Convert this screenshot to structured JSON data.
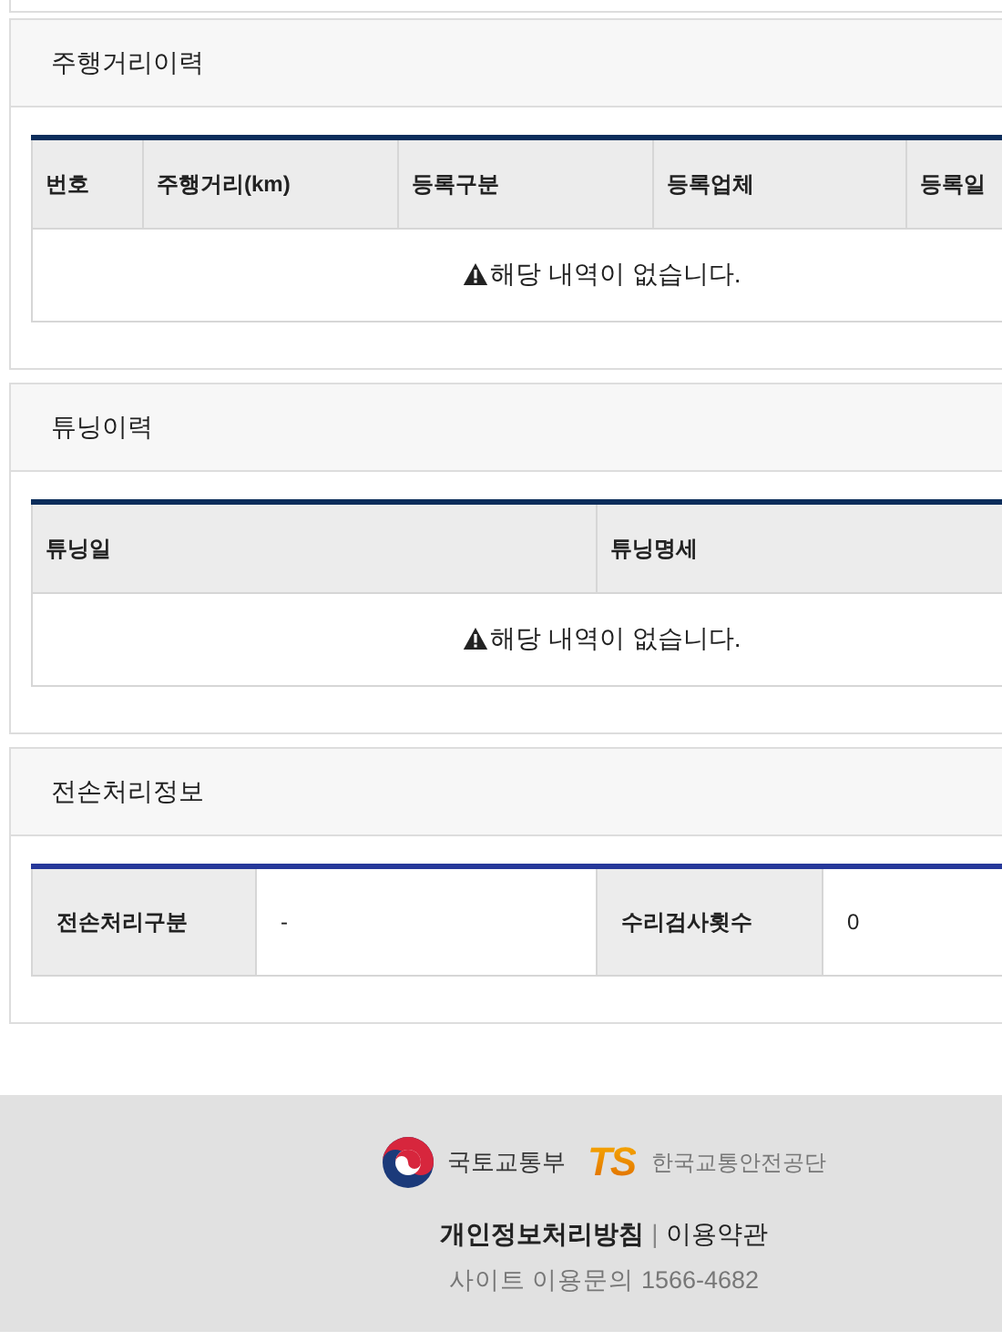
{
  "sections": [
    {
      "title": "주행거리이력",
      "kind": "list",
      "columns": [
        "번호",
        "주행거리(km)",
        "등록구분",
        "등록업체",
        "등록일"
      ],
      "empty_message": "해당 내역이 없습니다."
    },
    {
      "title": "튜닝이력",
      "kind": "list",
      "columns": [
        "튜닝일",
        "튜닝명세"
      ],
      "empty_message": "해당 내역이 없습니다."
    },
    {
      "title": "전손처리정보",
      "kind": "info",
      "fields": [
        {
          "label": "전손처리구분",
          "value": "-"
        },
        {
          "label": "수리검사횟수",
          "value": "0"
        }
      ]
    }
  ],
  "footer": {
    "ministry": "국토교통부",
    "ts_mark": "TS",
    "agency": "한국교통안전공단",
    "links": [
      {
        "label": "개인정보처리방침"
      },
      {
        "label": "이용약관"
      }
    ],
    "separator": "|",
    "contact": "사이트 이용문의 1566-4682"
  }
}
